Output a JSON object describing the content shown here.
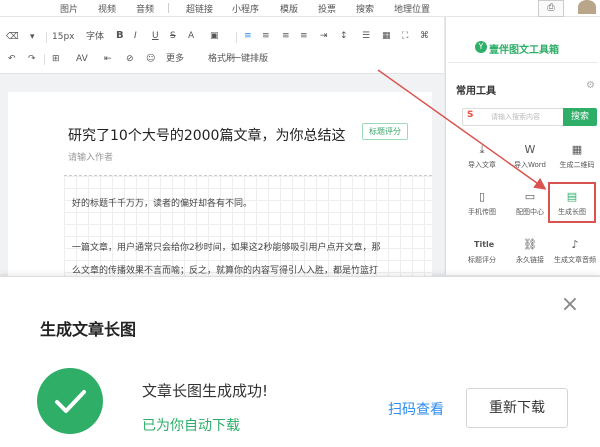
{
  "top_menu": {
    "items": [
      "图片",
      "视频",
      "音频",
      "超链接",
      "小程序",
      "模版",
      "投票",
      "搜索",
      "地理位置"
    ],
    "right_button": "⎙"
  },
  "toolbar": {
    "font_size": "15px",
    "font_family": "字体",
    "bold": "B",
    "italic": "I",
    "underline": "U",
    "strike": "S",
    "align": "A",
    "more": "更多",
    "format_brush": "格式刷",
    "one_key": "一键排版"
  },
  "article": {
    "title": "研究了10个大号的2000篇文章，为你总结这",
    "tag": "标题评分",
    "author_placeholder": "请输入作者",
    "p1": "好的标题千千万万，读者的偏好却各有不同。",
    "p2": "一篇文章，用户通常只会给你2秒时间，如果这2秒能够吸引用户点开文章，那",
    "p3": "么文章的传播效果不言而喻；反之，就算你的内容写得引人入胜，都是竹篮打"
  },
  "sidebar": {
    "brand": "壹伴图文工具箱",
    "section_title": "常用工具",
    "search_placeholder": "请输入搜索内容",
    "search_button": "搜索",
    "tools": [
      {
        "label": "导入文章",
        "icon": "import-icon"
      },
      {
        "label": "导入Word",
        "icon": "word-icon"
      },
      {
        "label": "生成二维码",
        "icon": "qrcode-icon"
      },
      {
        "label": "手机传图",
        "icon": "phone-icon"
      },
      {
        "label": "配图中心",
        "icon": "image-icon"
      },
      {
        "label": "生成长图",
        "icon": "long-image-icon"
      },
      {
        "label": "标题评分",
        "icon": "title-icon"
      },
      {
        "label": "永久链接",
        "icon": "link-icon"
      },
      {
        "label": "生成文章音频",
        "icon": "audio-icon"
      }
    ]
  },
  "dialog": {
    "title": "生成文章长图",
    "close": "×",
    "success_main": "文章长图生成成功!",
    "success_sub": "已为你自动下载",
    "scan_link": "扫码查看",
    "redownload_button": "重新下载"
  },
  "colors": {
    "accent_green": "#2fae68",
    "link_blue": "#2d8cf0",
    "highlight_red": "#d9534f"
  }
}
